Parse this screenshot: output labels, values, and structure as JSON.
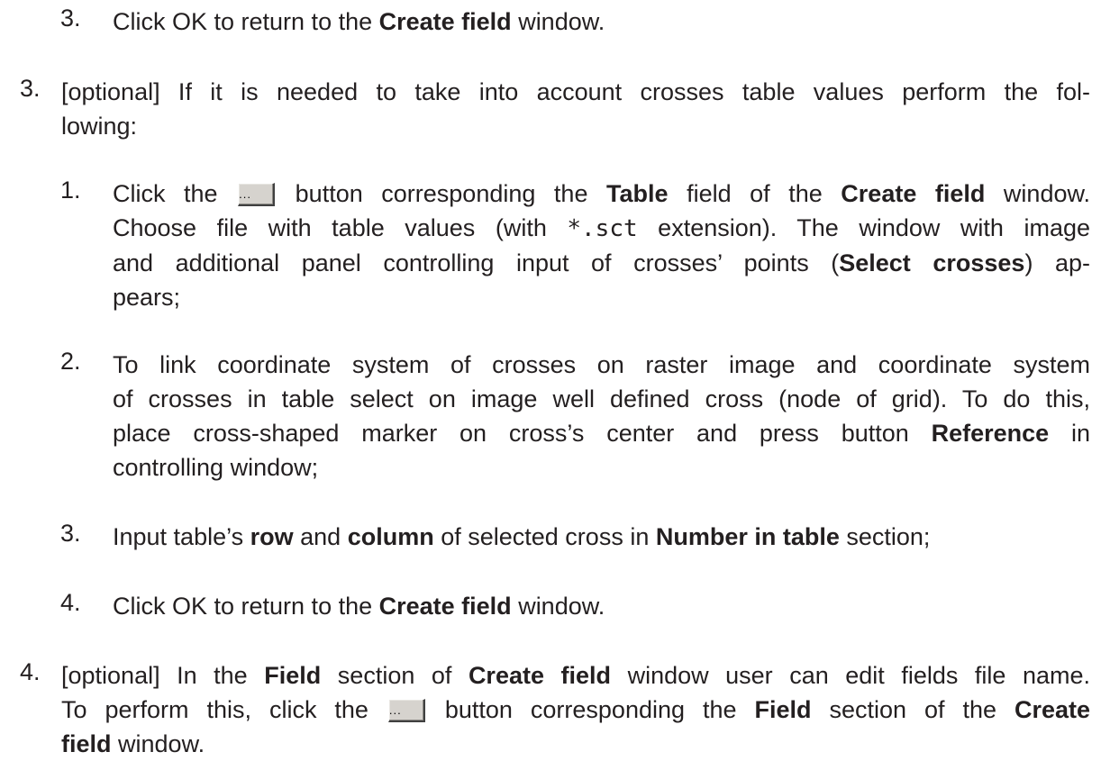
{
  "step_3_4": {
    "number": "3.",
    "text_a": "Click OK to return to the ",
    "bold_a": "Create field",
    "text_b": " window."
  },
  "step_3": {
    "number": "3.",
    "line1": "[optional] If it is needed to take into account crosses table values perform the fol-",
    "line2": "lowing:"
  },
  "sub_1": {
    "number": "1.",
    "l1_a": "Click the ",
    "button_glyph": "...",
    "l1_b": " button corresponding the ",
    "l1_bold1": "Table",
    "l1_c": " field of the ",
    "l1_bold2": "Create field",
    "l1_d": " window.",
    "l2_a": "Choose file with table values (with ",
    "l2_mono": "*.sct",
    "l2_b": " extension). The window with image",
    "l3_a": "and additional panel controlling input of crosses’ points (",
    "l3_bold": "Select crosses",
    "l3_b": ") ap-",
    "l4": "pears;"
  },
  "sub_2": {
    "number": "2.",
    "l1": "To link coordinate system of crosses on raster image and coordinate system",
    "l2": "of crosses in table select on image well defined cross (node of grid). To do this,",
    "l3_a": "place cross-shaped marker on cross’s center and press button ",
    "l3_bold": "Reference",
    "l3_b": " in",
    "l4": "controlling window;"
  },
  "sub_3": {
    "number": "3.",
    "text_a": "Input table’s ",
    "bold_a": "row",
    "text_b": " and ",
    "bold_b": "column",
    "text_c": " of selected cross in ",
    "bold_c": "Number in table",
    "text_d": " section;"
  },
  "sub_4": {
    "number": "4.",
    "text_a": "Click OK to return to the ",
    "bold_a": "Create field",
    "text_b": " window."
  },
  "step_4": {
    "number": "4.",
    "l1_a": "[optional] In the ",
    "l1_bold1": "Field",
    "l1_b": " section of ",
    "l1_bold2": "Create field",
    "l1_c": " window user can edit fields file name.",
    "l2_a": "To perform this, click the ",
    "button_glyph": "...",
    "l2_b": " button corresponding the ",
    "l2_bold1": "Field",
    "l2_c": " section of the ",
    "l2_bold2": "Create",
    "l3_bold": "field",
    "l3_a": " window."
  }
}
